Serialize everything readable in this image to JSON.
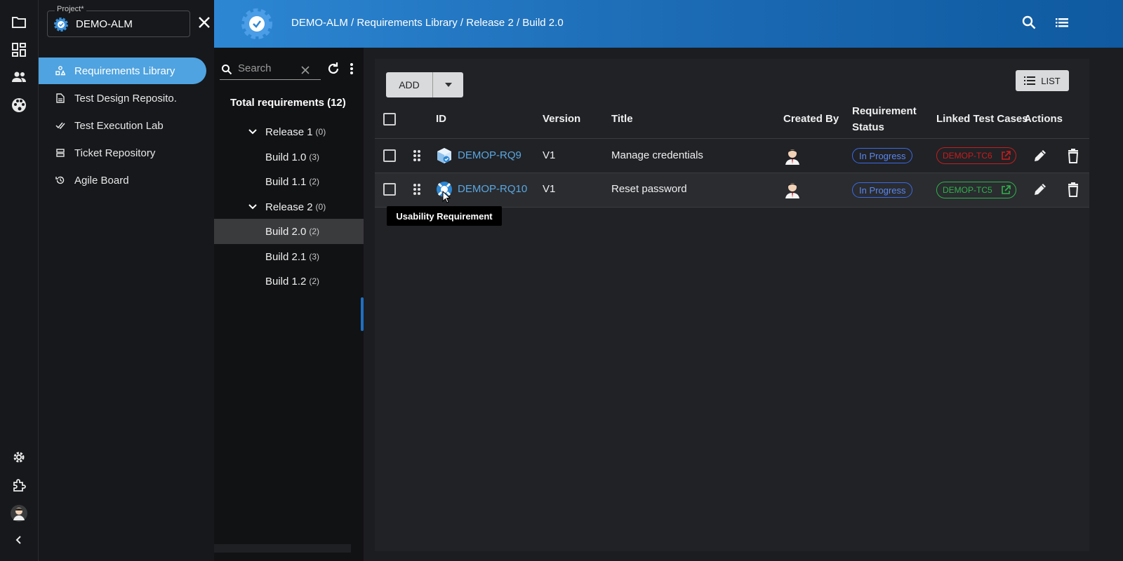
{
  "project": {
    "label": "Project*",
    "value": "DEMO-ALM"
  },
  "nav": {
    "items": [
      {
        "label": "Requirements Library",
        "icon": "requirements-icon",
        "active": true
      },
      {
        "label": "Test Design Reposito.",
        "icon": "document-icon"
      },
      {
        "label": "Test Execution Lab",
        "icon": "double-check-icon"
      },
      {
        "label": "Ticket Repository",
        "icon": "ticket-icon"
      },
      {
        "label": "Agile Board",
        "icon": "history-icon"
      }
    ]
  },
  "header": {
    "breadcrumb": "DEMO-ALM / Requirements Library / Release 2 / Build 2.0"
  },
  "tree": {
    "search_placeholder": "Search",
    "total": "Total requirements (12)",
    "nodes": [
      {
        "label": "Release 1",
        "count": "(0)",
        "level": 0
      },
      {
        "label": "Build 1.0",
        "count": "(3)",
        "level": 1
      },
      {
        "label": "Build 1.1",
        "count": "(2)",
        "level": 1
      },
      {
        "label": "Release 2",
        "count": "(0)",
        "level": 0
      },
      {
        "label": "Build 2.0",
        "count": "(2)",
        "level": 1,
        "selected": true
      },
      {
        "label": "Build 2.1",
        "count": "(3)",
        "level": 1
      },
      {
        "label": "Build 1.2",
        "count": "(2)",
        "level": 1
      }
    ]
  },
  "toolbar": {
    "add_label": "ADD",
    "list_label": "LIST"
  },
  "table": {
    "headers": {
      "id": "ID",
      "version": "Version",
      "title": "Title",
      "created_by": "Created By",
      "status_line1": "Requirement",
      "status_line2": "Status",
      "linked": "Linked Test Cases",
      "actions": "Actions"
    },
    "rows": [
      {
        "id": "DEMOP-RQ9",
        "version": "V1",
        "title": "Manage credentials",
        "status": "In Progress",
        "linked": "DEMOP-TC6",
        "linked_color": "#c81c1c"
      },
      {
        "id": "DEMOP-RQ10",
        "version": "V1",
        "title": "Reset password",
        "status": "In Progress",
        "linked": "DEMOP-TC5",
        "linked_color": "#2fb34a"
      }
    ]
  },
  "tooltip": "Usability Requirement",
  "colors": {
    "accent": "#4fa3e0",
    "status_blue": "#3b6ae8",
    "header_start": "#2d87d3",
    "header_end": "#0f5aa0"
  }
}
